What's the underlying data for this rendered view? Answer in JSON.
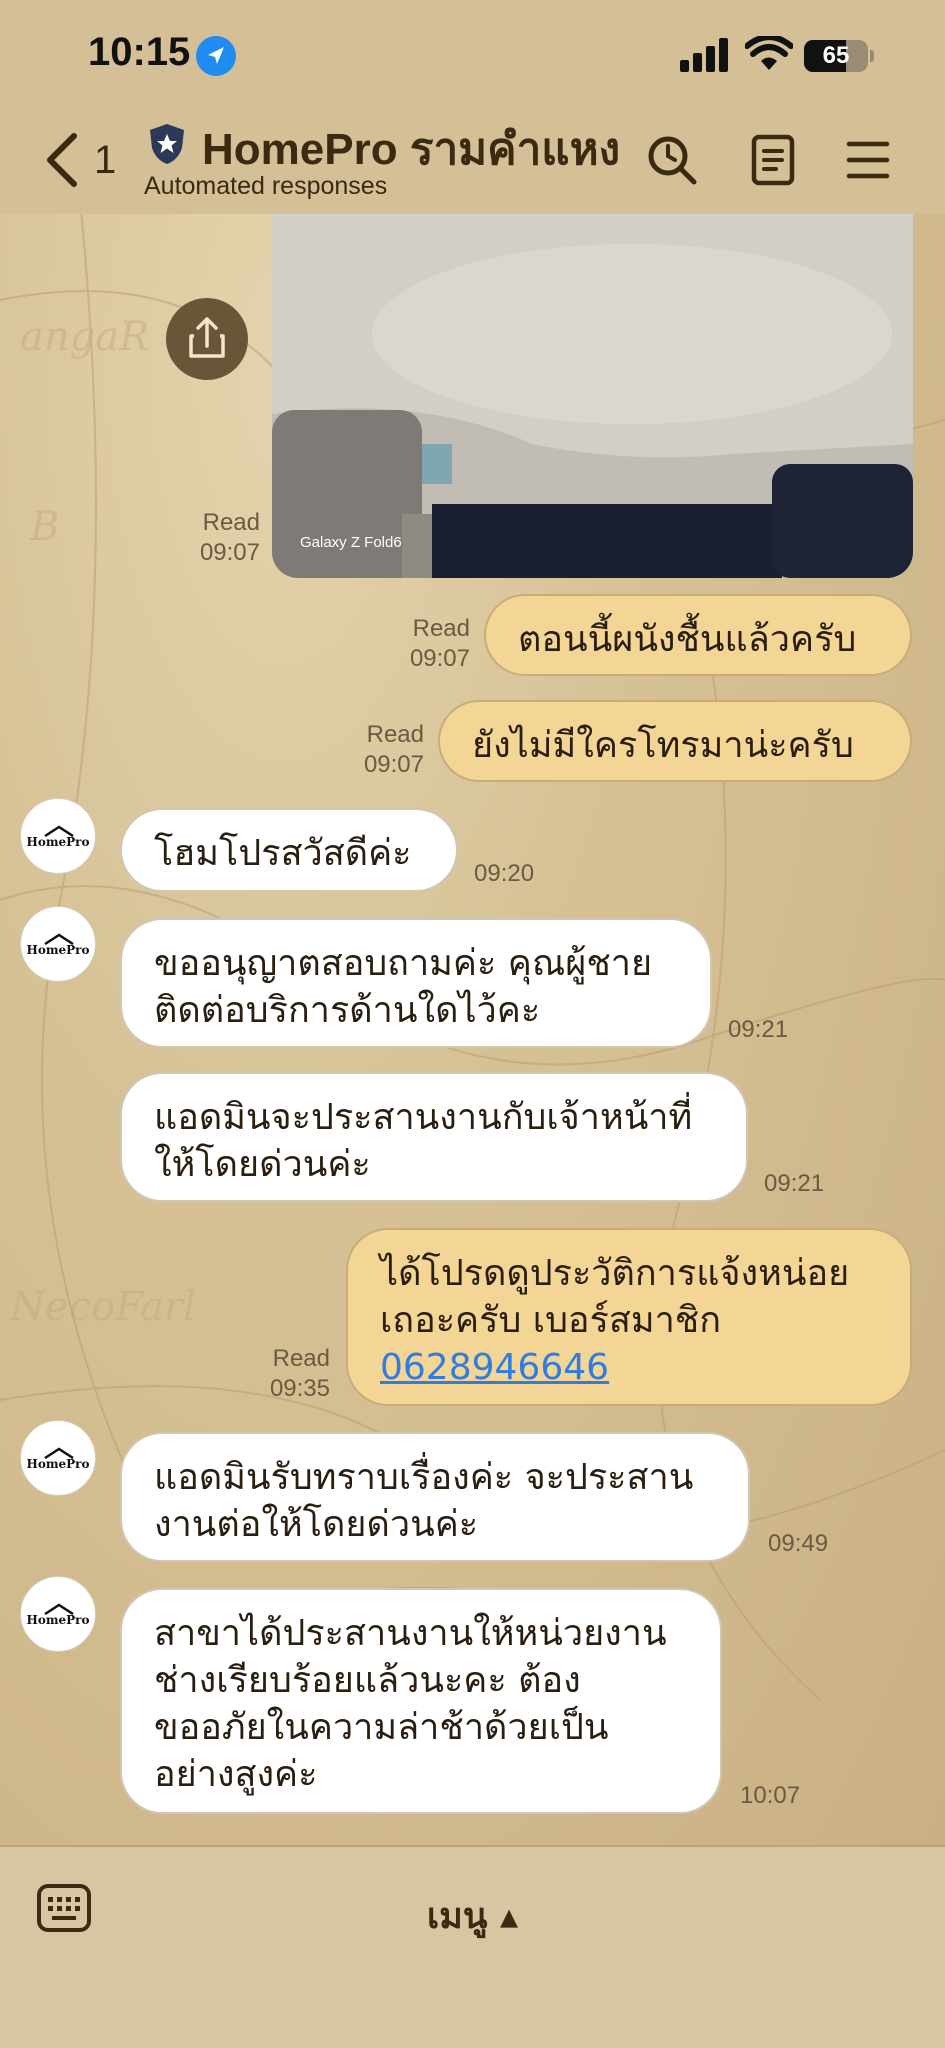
{
  "status_bar": {
    "time": "10:15",
    "battery": "65",
    "battery_level": 0.65
  },
  "header": {
    "unread_count": "1",
    "title": "HomePro รามคำแหง",
    "subtitle": "Automated responses"
  },
  "photo": {
    "watermark": "Galaxy Z Fold6",
    "read_label": "Read",
    "time": "09:07"
  },
  "messages": [
    {
      "side": "out",
      "text": "ตอนนี้ผนังชื้นแล้วครับ",
      "read": "Read",
      "time": "09:07"
    },
    {
      "side": "out",
      "text": "ยังไม่มีใครโทรมาน่ะครับ",
      "read": "Read",
      "time": "09:07"
    },
    {
      "side": "in",
      "text": "โฮมโปรสวัสดีค่ะ",
      "time": "09:20"
    },
    {
      "side": "in",
      "line1": "ขออนุญาตสอบถามค่ะ คุณผู้ชาย",
      "line2": "ติดต่อบริการด้านใดไว้คะ",
      "time": "09:21"
    },
    {
      "side": "in",
      "line1": "แอดมินจะประสานงานกับเจ้าหน้าที่",
      "line2": "ให้โดยด่วนค่ะ",
      "time": "09:21"
    },
    {
      "side": "out",
      "line1": "ได้โปรดดูประวัติการแจ้งหน่อย",
      "line2": "เถอะครับ เบอร์สมาชิก",
      "link": "0628946646",
      "read": "Read",
      "time": "09:35"
    },
    {
      "side": "in",
      "line1": "แอดมินรับทราบเรื่องค่ะ จะประสาน",
      "line2": "งานต่อให้โดยด่วนค่ะ",
      "time": "09:49"
    },
    {
      "side": "in",
      "line1": "สาขาได้ประสานงานให้หน่วยงาน",
      "line2": "ช่างเรียบร้อยแล้วนะคะ ต้อง",
      "line3": "ขออภัยในความล่าช้าด้วยเป็น",
      "line4": "อย่างสูงค่ะ",
      "time": "10:07"
    }
  ],
  "avatar": {
    "logo_text": "HomePro"
  },
  "bottom_bar": {
    "menu_label": "เมนู ▴"
  },
  "colors": {
    "accent_link": "#2f7de1",
    "out_bubble": "#f3d596",
    "in_bubble": "#ffffff",
    "header_bg": "#d4bf96"
  }
}
